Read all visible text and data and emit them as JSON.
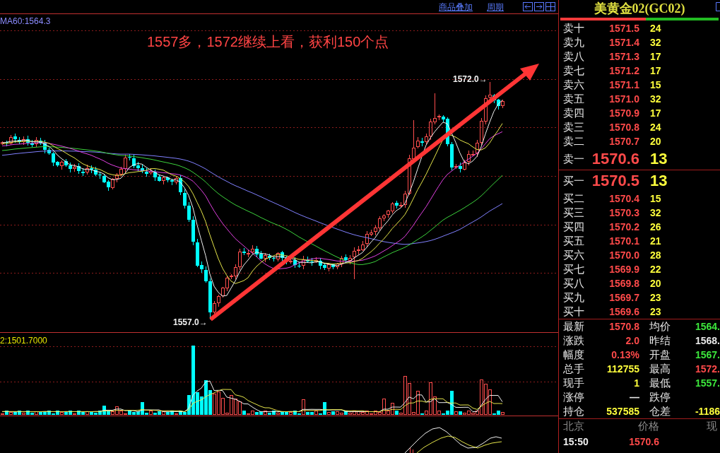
{
  "toolbar": {
    "links": [
      {
        "label": "商品叠加"
      },
      {
        "label": "周期"
      }
    ]
  },
  "main_chart": {
    "indicator_label": "MA60:1564.3",
    "annotation": "1557多，1572继续上看，获利150个点",
    "high_marker": "1572.0→",
    "low_marker": "1557.0→"
  },
  "volume_chart": {
    "indicator_label": "2:1501.7000"
  },
  "quote_panel": {
    "title": "美黄金02(GC02)",
    "ratio_bar": {
      "level": 0.54
    },
    "asks": [
      {
        "kind": "level",
        "label": "卖十",
        "price": "1571.5",
        "volume": "24"
      },
      {
        "kind": "level",
        "label": "卖九",
        "price": "1571.4",
        "volume": "32"
      },
      {
        "kind": "level",
        "label": "卖八",
        "price": "1571.3",
        "volume": "17"
      },
      {
        "kind": "level",
        "label": "卖七",
        "price": "1571.2",
        "volume": "17"
      },
      {
        "kind": "level",
        "label": "卖六",
        "price": "1571.1",
        "volume": "15"
      },
      {
        "kind": "level",
        "label": "卖五",
        "price": "1571.0",
        "volume": "32"
      },
      {
        "kind": "level",
        "label": "卖四",
        "price": "1570.9",
        "volume": "17"
      },
      {
        "kind": "level",
        "label": "卖三",
        "price": "1570.8",
        "volume": "24"
      },
      {
        "kind": "level",
        "label": "卖二",
        "price": "1570.7",
        "volume": "20"
      },
      {
        "kind": "best",
        "label": "卖一",
        "price": "1570.6",
        "volume": "13"
      }
    ],
    "bids": [
      {
        "kind": "best",
        "label": "买一",
        "price": "1570.5",
        "volume": "13"
      },
      {
        "kind": "level",
        "label": "买二",
        "price": "1570.4",
        "volume": "15"
      },
      {
        "kind": "level",
        "label": "买三",
        "price": "1570.3",
        "volume": "32"
      },
      {
        "kind": "level",
        "label": "买四",
        "price": "1570.2",
        "volume": "26"
      },
      {
        "kind": "level",
        "label": "买五",
        "price": "1570.1",
        "volume": "21"
      },
      {
        "kind": "level",
        "label": "买六",
        "price": "1570.0",
        "volume": "28"
      },
      {
        "kind": "level",
        "label": "买七",
        "price": "1569.9",
        "volume": "22"
      },
      {
        "kind": "level",
        "label": "买八",
        "price": "1569.8",
        "volume": "20"
      },
      {
        "kind": "level",
        "label": "买九",
        "price": "1569.7",
        "volume": "23"
      },
      {
        "kind": "level",
        "label": "买十",
        "price": "1569.6",
        "volume": "23"
      }
    ],
    "stats": [
      {
        "label": "最新",
        "value": "1570.8",
        "color": "#ff4a4a"
      },
      {
        "label": "均价",
        "value": "1564.",
        "color": "#3ce63c"
      },
      {
        "label": "涨跌",
        "value": "2.0",
        "color": "#ff4a4a"
      },
      {
        "label": "昨结",
        "value": "1568.",
        "color": "#e8e8e8"
      },
      {
        "label": "幅度",
        "value": "0.13%",
        "color": "#ff4a4a"
      },
      {
        "label": "开盘",
        "value": "1567.",
        "color": "#3ce63c"
      },
      {
        "label": "总手",
        "value": "112755",
        "color": "#ffff3c"
      },
      {
        "label": "最高",
        "value": "1572.",
        "color": "#ff4a4a"
      },
      {
        "label": "现手",
        "value": "1",
        "color": "#ffff3c"
      },
      {
        "label": "最低",
        "value": "1557.",
        "color": "#3ce63c"
      },
      {
        "label": "涨停",
        "value": "—",
        "color": "#e8e8e8"
      },
      {
        "label": "跌停"
      },
      {
        "label": "持仓",
        "value": "537585",
        "color": "#ffff3c"
      },
      {
        "label": "仓差",
        "value": "-1186",
        "color": "#ffff3c"
      }
    ],
    "time_sales": {
      "columns": [
        "北京",
        "价格",
        "现"
      ],
      "rows": [
        {
          "time": "15:50",
          "price": "1570.6"
        }
      ]
    }
  }
}
